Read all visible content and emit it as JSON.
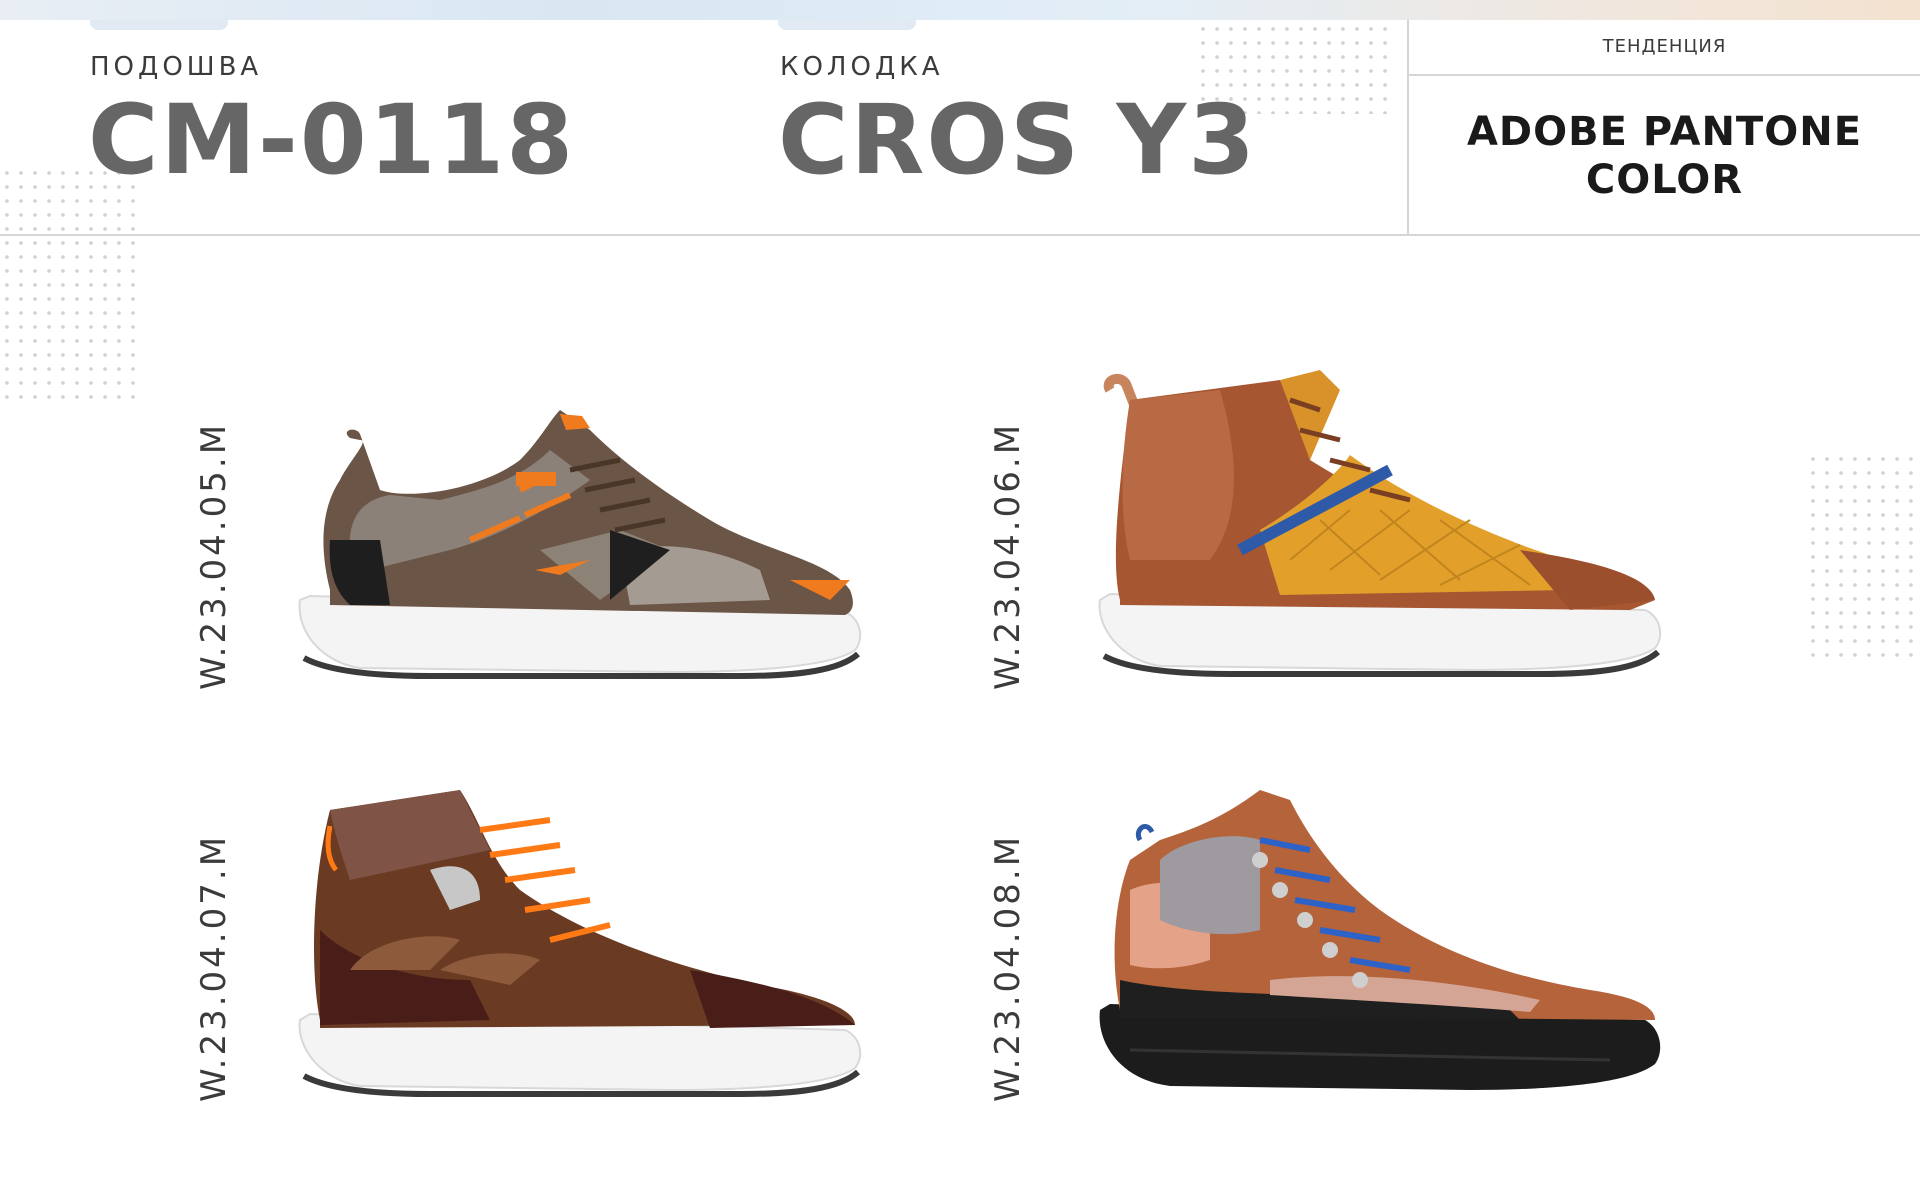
{
  "header": {
    "sole_caption": "ПОДОШВА",
    "sole_code": "CM-0118",
    "last_caption": "КОЛОДКА",
    "last_code": "CROS Y3",
    "trend_caption": "ТЕНДЕНЦИЯ",
    "trend_line1": "ADOBE PANTONE",
    "trend_line2": "COLOR"
  },
  "products": [
    {
      "code": "W.23.04.05.M",
      "image": "low-top-sneaker-brown-grey-orange"
    },
    {
      "code": "W.23.04.06.M",
      "image": "high-top-sneaker-rust-mustard-quilted"
    },
    {
      "code": "W.23.04.07.M",
      "image": "high-top-sneaker-dark-brown-orange-laces"
    },
    {
      "code": "W.23.04.08.M",
      "image": "hiking-sneaker-tan-black-blue-laces"
    }
  ],
  "colors": {
    "code_grey": "#666666",
    "caption_text": "#3b3b3b",
    "trend_text": "#1a1a1a",
    "divider": "#d5d5d5"
  }
}
